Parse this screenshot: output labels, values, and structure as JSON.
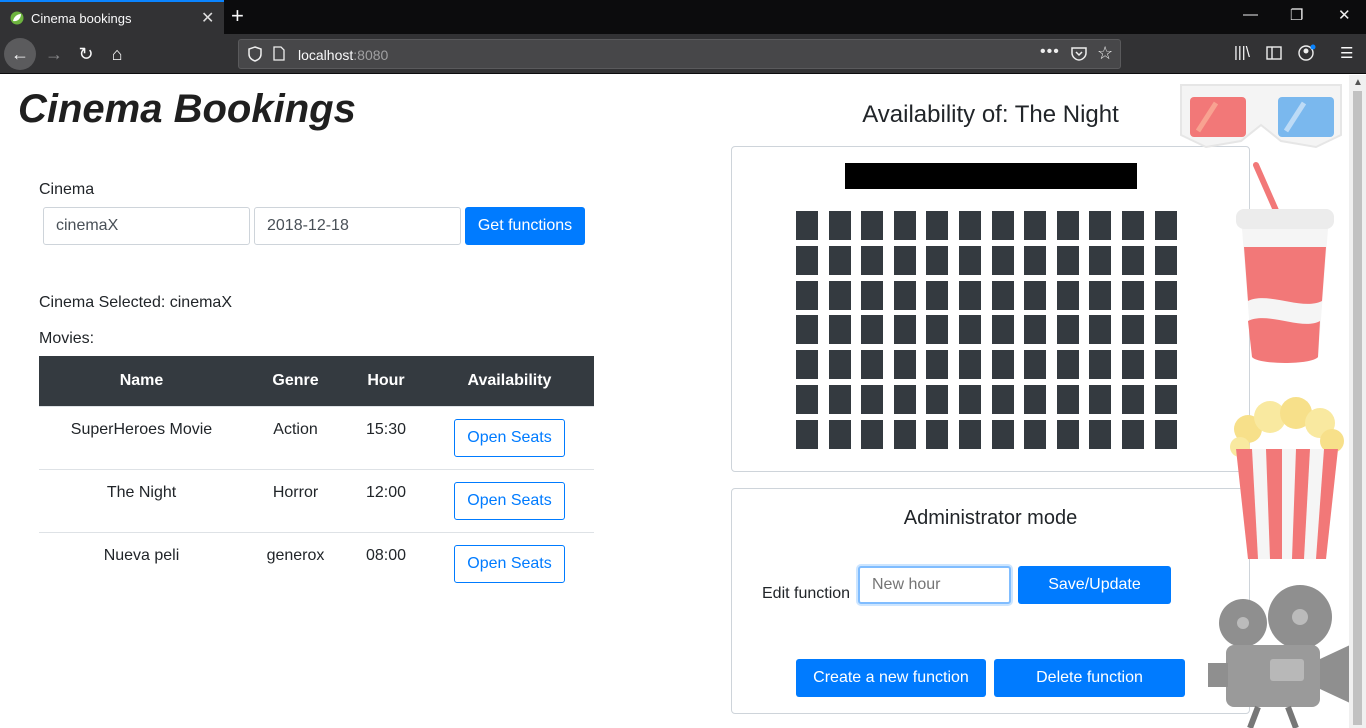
{
  "browser": {
    "tab_title": "Cinema bookings",
    "tab_close": "✕",
    "new_tab": "+",
    "url_host": "localhost",
    "url_port": ":8080",
    "url_actions": "•••",
    "star": "☆",
    "win_min": "—",
    "win_max": "❐",
    "win_close": "✕",
    "back": "←",
    "forward": "→",
    "reload": "↻",
    "home": "⌂",
    "library": "|||\\",
    "sidebar": "▯",
    "menu": "☰"
  },
  "page": {
    "title": "Cinema Bookings",
    "cinema_label": "Cinema",
    "cinema_value": "cinemaX",
    "date_value": "2018-12-18",
    "get_functions": "Get functions",
    "cinema_selected": "Cinema Selected: cinemaX",
    "movies_label": "Movies:",
    "table": {
      "headers": [
        "Name",
        "Genre",
        "Hour",
        "Availability"
      ],
      "rows": [
        {
          "name": "SuperHeroes Movie",
          "genre": "Action",
          "hour": "15:30",
          "action": "Open Seats"
        },
        {
          "name": "The Night",
          "genre": "Horror",
          "hour": "12:00",
          "action": "Open Seats"
        },
        {
          "name": "Nueva peli",
          "genre": "generox",
          "hour": "08:00",
          "action": "Open Seats"
        }
      ]
    },
    "availability_title": "Availability of: The Night",
    "seat_grid": {
      "rows": 7,
      "cols": 12,
      "status": "available"
    },
    "admin": {
      "title": "Administrator mode",
      "edit_label": "Edit function",
      "new_hour_placeholder": "New hour",
      "save_update": "Save/Update",
      "create_new": "Create a new function",
      "delete": "Delete function"
    }
  },
  "colors": {
    "primary": "#007bff",
    "table_header": "#343a40",
    "seat": "#343a40",
    "chrome_dark": "#0c0c0d",
    "tab_accent": "#0a84ff"
  },
  "icons": [
    "spring-leaf-icon",
    "shield-icon",
    "page-icon",
    "pocket-icon",
    "star-icon",
    "library-icon",
    "sidebar-icon",
    "account-icon",
    "menu-icon",
    "3d-glasses-icon",
    "soda-cup-icon",
    "popcorn-icon",
    "movie-camera-icon"
  ]
}
